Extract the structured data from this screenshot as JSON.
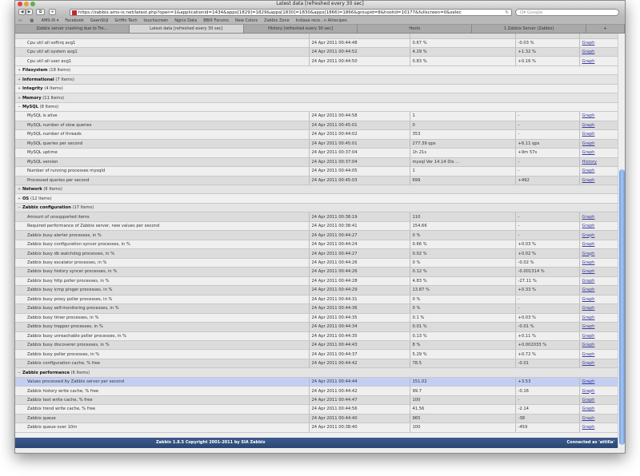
{
  "window": {
    "title": "Latest data [refreshed every 30 sec]"
  },
  "toolbar": {
    "url": "https://zabbix.ams-ix.net/latest.php?open=1&applicationid=1434&apps[1829]=1829&apps[1830]=1830&apps[1866]=1866&groupid=8&hostid=10177&fullscreen=0&selec",
    "search_placeholder": "Q▾ Google"
  },
  "bookmarks": [
    "AMS-IX ▾",
    "Facebook",
    "GeenStijl",
    "Griffin Tech",
    "touchscreen",
    "Nginx Data",
    "BBIX Forums",
    "New Colors",
    "Zabbix Zone",
    "Indiase rece...n Allrecipes"
  ],
  "tabs": [
    {
      "label": "Zabbix server crashing due to Tre..."
    },
    {
      "label": "Latest data [refreshed every 30 sec]",
      "active": true
    },
    {
      "label": "History [refreshed every 30 sec]"
    },
    {
      "label": "Hosts"
    },
    {
      "label": "1 Zabbix Server (Zabbix)"
    },
    {
      "label": ""
    }
  ],
  "rows": [
    {
      "type": "item",
      "name": "Cpu util all softirq avg1",
      "date": "24 Apr 2011 00:44:48",
      "value": "0.67 %",
      "change": "-0.03 %",
      "link": "Graph"
    },
    {
      "type": "item",
      "name": "Cpu util all system avg1",
      "date": "24 Apr 2011 00:44:52",
      "value": "4.29 %",
      "change": "+1.32 %",
      "link": "Graph"
    },
    {
      "type": "item",
      "name": "Cpu util all user avg1",
      "date": "24 Apr 2011 00:44:50",
      "value": "0.83 %",
      "change": "+0.16 %",
      "link": "Graph"
    },
    {
      "type": "group",
      "toggle": "+",
      "name": "Filesystem",
      "count": "(18 Items)"
    },
    {
      "type": "group",
      "toggle": "+",
      "name": "Informational",
      "count": "(7 Items)"
    },
    {
      "type": "group",
      "toggle": "+",
      "name": "Integrity",
      "count": "(4 Items)"
    },
    {
      "type": "group",
      "toggle": "+",
      "name": "Memory",
      "count": "(11 Items)"
    },
    {
      "type": "group",
      "toggle": "−",
      "name": "MySQL",
      "count": "(8 Items)"
    },
    {
      "type": "item",
      "name": "MySQL is alive",
      "date": "24 Apr 2011 00:44:58",
      "value": "1",
      "change": "-",
      "link": "Graph"
    },
    {
      "type": "item",
      "name": "MySQL number of slow queries",
      "date": "24 Apr 2011 00:45:01",
      "value": "0",
      "change": "-",
      "link": "Graph"
    },
    {
      "type": "item",
      "name": "MySQL number of threads",
      "date": "24 Apr 2011 00:44:02",
      "value": "353",
      "change": "-",
      "link": "Graph"
    },
    {
      "type": "item",
      "name": "MySQL queries per second",
      "date": "24 Apr 2011 00:45:01",
      "value": "277.39 qps",
      "change": "+6.11 qps",
      "link": "Graph"
    },
    {
      "type": "item",
      "name": "MySQL uptime",
      "date": "24 Apr 2011 00:37:04",
      "value": "1h 21s",
      "change": "+9m 57s",
      "link": "Graph"
    },
    {
      "type": "item",
      "name": "MySQL version",
      "date": "24 Apr 2011 00:37:04",
      "value": "mysql  Ver 14.14 Dis ...",
      "change": "-",
      "link": "History"
    },
    {
      "type": "item",
      "name": "Number of running processes mysqld",
      "date": "24 Apr 2011 00:44:05",
      "value": "1",
      "change": "-",
      "link": "Graph"
    },
    {
      "type": "item",
      "name": "Processed queries per second",
      "date": "24 Apr 2011 00:45:03",
      "value": "699",
      "change": "+492",
      "link": "Graph"
    },
    {
      "type": "group",
      "toggle": "+",
      "name": "Network",
      "count": "(6 Items)"
    },
    {
      "type": "group",
      "toggle": "+",
      "name": "OS",
      "count": "(12 Items)"
    },
    {
      "type": "group",
      "toggle": "−",
      "name": "Zabbix configuration",
      "count": "(17 Items)"
    },
    {
      "type": "item",
      "name": "Amount of unsupported items",
      "date": "24 Apr 2011 00:38:19",
      "value": "110",
      "change": "-",
      "link": "Graph"
    },
    {
      "type": "item",
      "name": "Required performance of Zabbix server, new values per second",
      "date": "24 Apr 2011 00:38:41",
      "value": "154.66",
      "change": "-",
      "link": "Graph"
    },
    {
      "type": "item",
      "name": "Zabbix busy alerter processes, in %",
      "date": "24 Apr 2011 00:44:27",
      "value": "0 %",
      "change": "-",
      "link": "Graph"
    },
    {
      "type": "item",
      "name": "Zabbix busy configuration syncer processes, in %",
      "date": "24 Apr 2011 00:44:24",
      "value": "0.66 %",
      "change": "+0.03 %",
      "link": "Graph"
    },
    {
      "type": "item",
      "name": "Zabbix busy db watchdog processes, in %",
      "date": "24 Apr 2011 00:44:27",
      "value": "0.02 %",
      "change": "+0.02 %",
      "link": "Graph"
    },
    {
      "type": "item",
      "name": "Zabbix busy escalator processes, in %",
      "date": "24 Apr 2011 00:44:26",
      "value": "0 %",
      "change": "-0.02 %",
      "link": "Graph"
    },
    {
      "type": "item",
      "name": "Zabbix busy history syncer processes, in %",
      "date": "24 Apr 2011 00:44:26",
      "value": "0.12 %",
      "change": "-0.001314 %",
      "link": "Graph"
    },
    {
      "type": "item",
      "name": "Zabbix busy http poller processes, in %",
      "date": "24 Apr 2011 00:44:28",
      "value": "4.83 %",
      "change": "-27.11 %",
      "link": "Graph"
    },
    {
      "type": "item",
      "name": "Zabbix busy icmp pinger processes, in %",
      "date": "24 Apr 2011 00:44:29",
      "value": "13.87 %",
      "change": "+0.33 %",
      "link": "Graph"
    },
    {
      "type": "item",
      "name": "Zabbix busy proxy poller processes, in %",
      "date": "24 Apr 2011 00:44:31",
      "value": "0 %",
      "change": "-",
      "link": "Graph"
    },
    {
      "type": "item",
      "name": "Zabbix busy self-monitoring processes, in %",
      "date": "24 Apr 2011 00:44:36",
      "value": "0 %",
      "change": "-",
      "link": "Graph"
    },
    {
      "type": "item",
      "name": "Zabbix busy timer processes, in %",
      "date": "24 Apr 2011 00:44:35",
      "value": "0.1 %",
      "change": "+0.03 %",
      "link": "Graph"
    },
    {
      "type": "item",
      "name": "Zabbix busy trapper processes, in %",
      "date": "24 Apr 2011 00:44:34",
      "value": "0.01 %",
      "change": "-0.01 %",
      "link": "Graph"
    },
    {
      "type": "item",
      "name": "Zabbix busy unreachable poller processes, in %",
      "date": "24 Apr 2011 00:44:35",
      "value": "0.13 %",
      "change": "+0.11 %",
      "link": "Graph"
    },
    {
      "type": "item",
      "name": "Zabbix busy discoverer processes, in %",
      "date": "24 Apr 2011 00:44:43",
      "value": "8 %",
      "change": "+0.002033 %",
      "link": "Graph"
    },
    {
      "type": "item",
      "name": "Zabbix busy poller processes, in %",
      "date": "24 Apr 2011 00:44:37",
      "value": "5.29 %",
      "change": "+0.72 %",
      "link": "Graph"
    },
    {
      "type": "item",
      "name": "Zabbix configuration cache, % free",
      "date": "24 Apr 2011 00:44:42",
      "value": "78.5",
      "change": "-0.01",
      "link": "Graph"
    },
    {
      "type": "group",
      "toggle": "−",
      "name": "Zabbix performance",
      "count": "(6 Items)"
    },
    {
      "type": "item",
      "selected": true,
      "name": "Values processed by Zabbix server per second",
      "date": "24 Apr 2011 00:44:44",
      "value": "151.02",
      "change": "+3.53",
      "link": "Graph"
    },
    {
      "type": "item",
      "name": "Zabbix history write cache, % free",
      "date": "24 Apr 2011 00:44:42",
      "value": "99.7",
      "change": "-0.16",
      "link": "Graph"
    },
    {
      "type": "item",
      "name": "Zabbix text write cache, % free",
      "date": "24 Apr 2011 00:44:47",
      "value": "100",
      "change": "-",
      "link": "Graph"
    },
    {
      "type": "item",
      "name": "Zabbix trend write cache, % free",
      "date": "24 Apr 2011 00:44:56",
      "value": "41.56",
      "change": "-2.14",
      "link": "Graph"
    },
    {
      "type": "item",
      "name": "Zabbix queue",
      "date": "24 Apr 2011 00:44:40",
      "value": "965",
      "change": "-38",
      "link": "Graph"
    },
    {
      "type": "item",
      "name": "Zabbix queue over 10m",
      "date": "24 Apr 2011 00:38:40",
      "value": "100",
      "change": "-459",
      "link": "Graph"
    }
  ],
  "footer": {
    "copyright": "Zabbix 1.8.5 Copyright 2001-2011 by SIA Zabbix",
    "connected": "Connected as 'attilla'"
  }
}
